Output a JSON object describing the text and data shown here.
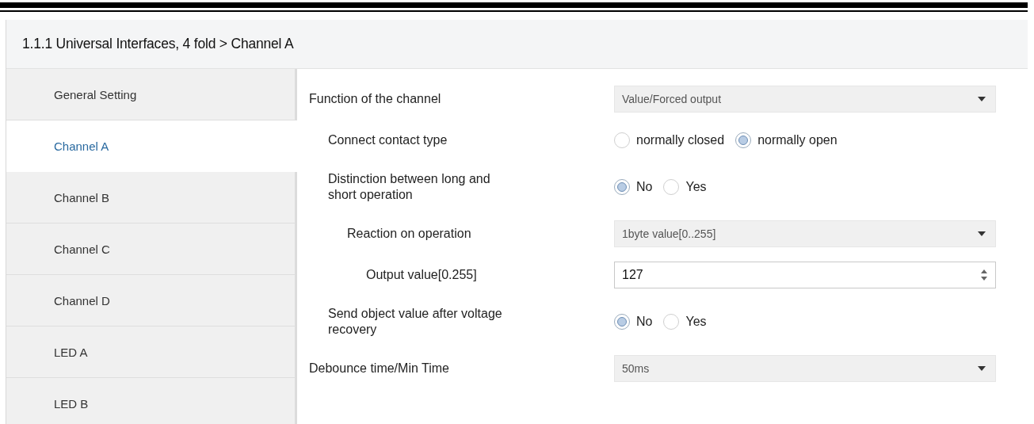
{
  "header": {
    "title": "1.1.1 Universal Interfaces, 4 fold > Channel A"
  },
  "sidebar": {
    "items": [
      {
        "label": "General Setting",
        "selected": false
      },
      {
        "label": "Channel A",
        "selected": true
      },
      {
        "label": "Channel B",
        "selected": false
      },
      {
        "label": "Channel C",
        "selected": false
      },
      {
        "label": "Channel D",
        "selected": false
      },
      {
        "label": "LED A",
        "selected": false
      },
      {
        "label": "LED B",
        "selected": false
      }
    ]
  },
  "parameters": [
    {
      "label": "Function of the channel",
      "kind": "dropdown",
      "value": "Value/Forced output",
      "children": [
        {
          "label": "Connect contact type",
          "kind": "radio",
          "options": [
            {
              "label": "normally closed",
              "selected": false
            },
            {
              "label": "normally open",
              "selected": true
            }
          ]
        },
        {
          "label": "Distinction between long and short operation",
          "kind": "radio",
          "options": [
            {
              "label": "No",
              "selected": true
            },
            {
              "label": "Yes",
              "selected": false
            }
          ],
          "children": [
            {
              "label": "Reaction on operation",
              "kind": "dropdown",
              "value": "1byte value[0..255]",
              "children": [
                {
                  "label": "Output value[0.255]",
                  "kind": "spinner",
                  "value": "127"
                }
              ]
            }
          ]
        },
        {
          "label": "Send object value after voltage recovery",
          "kind": "radio",
          "options": [
            {
              "label": "No",
              "selected": true
            },
            {
              "label": "Yes",
              "selected": false
            }
          ]
        }
      ]
    },
    {
      "label": "Debounce time/Min Time",
      "kind": "dropdown",
      "value": "50ms"
    }
  ]
}
